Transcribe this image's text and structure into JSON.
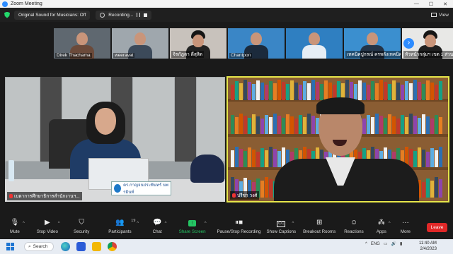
{
  "window": {
    "title": "Zoom Meeting",
    "minimize_icon": "minimize-icon",
    "maximize_icon": "maximize-icon",
    "close_icon": "close-icon"
  },
  "topbar": {
    "original_sound": "Original Sound for Musicians: Off",
    "recording": "Recording...",
    "view": "View"
  },
  "gallery": [
    {
      "name": "Direk Thachama"
    },
    {
      "name": "weeravat"
    },
    {
      "name": "จิรภัฎดา ดีสุสิด"
    },
    {
      "name": "Chantpon"
    },
    {
      "name": ""
    },
    {
      "name": "เทคนิคปูกรณ์ ครหลังเทคนิค"
    },
    {
      "name": "หัวหน้ากลุ่มฯ เขต 1 ส่วน"
    }
  ],
  "speakers": {
    "left": {
      "name": "เบตาการศึกษาธิการสำนักงานฯ...",
      "nameplate": "ดร.กาญจนประพินทร์ นพรมินท์"
    },
    "right": {
      "name": "ปรีชา วงศ์"
    }
  },
  "toolbar": {
    "items": [
      {
        "label": "Mute",
        "icon": "mic-icon"
      },
      {
        "label": "Stop Video",
        "icon": "video-icon"
      },
      {
        "label": "Security",
        "icon": "shield-icon"
      },
      {
        "label": "Participants",
        "icon": "participants-icon",
        "count": "19"
      },
      {
        "label": "Chat",
        "icon": "chat-icon"
      },
      {
        "label": "Share Screen",
        "icon": "share-screen-icon"
      },
      {
        "label": "Pause/Stop Recording",
        "icon": "recording-icon"
      },
      {
        "label": "Show Captions",
        "icon": "captions-icon",
        "box": "CC"
      },
      {
        "label": "Breakout Rooms",
        "icon": "breakout-icon"
      },
      {
        "label": "Reactions",
        "icon": "reactions-icon"
      },
      {
        "label": "Apps",
        "icon": "apps-icon"
      },
      {
        "label": "More",
        "icon": "more-icon"
      }
    ],
    "leave": "Leave"
  },
  "taskbar": {
    "search": "Search",
    "lang": "ENG",
    "time": "11:40 AM",
    "date": "2/4/2023"
  },
  "colors": {
    "zoom_blue": "#2d8cff",
    "active_speaker": "#e6e64a",
    "share_green": "#24c463",
    "leave_red": "#e02828"
  }
}
